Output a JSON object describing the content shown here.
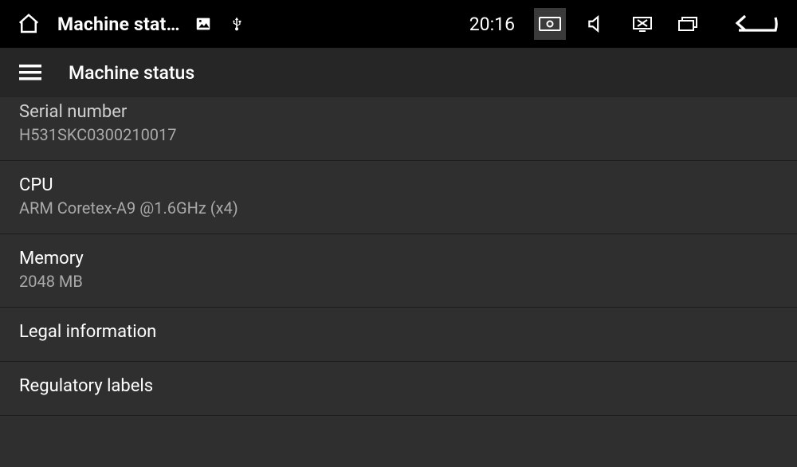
{
  "status_bar": {
    "title": "Machine stat…",
    "time": "20:16"
  },
  "appbar": {
    "title": "Machine status"
  },
  "items": [
    {
      "title": "Serial number",
      "subtitle": "H531SKC0300210017"
    },
    {
      "title": "CPU",
      "subtitle": "ARM Coretex-A9 @1.6GHz (x4)"
    },
    {
      "title": "Memory",
      "subtitle": "2048 MB"
    },
    {
      "title": "Legal information",
      "subtitle": ""
    },
    {
      "title": "Regulatory labels",
      "subtitle": ""
    }
  ]
}
